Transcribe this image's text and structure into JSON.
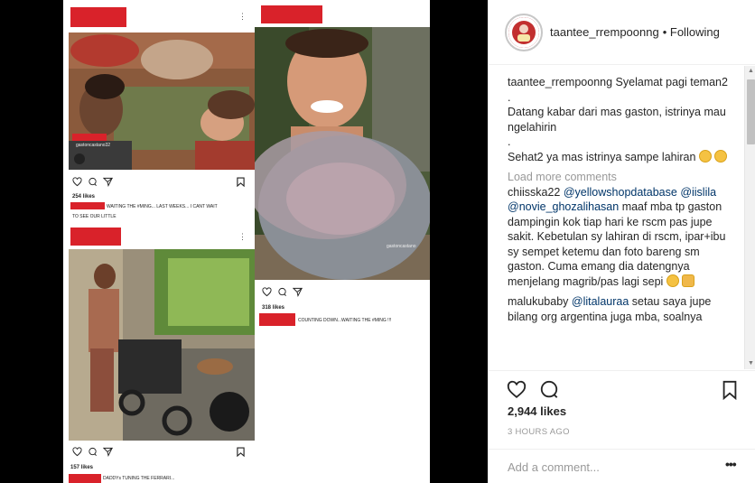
{
  "collage": {
    "top_left": {
      "photo_tag": "gastoncastano32",
      "likes": "254 likes",
      "caption": "WAITING THE #MING... LAST WEEKS... I CANT WAIT",
      "caption_line2": "TO SEE OUR LITTLE"
    },
    "right": {
      "photo_tag": "gastoncastano",
      "likes": "318 likes",
      "caption": "COUNTING DOWN...WAITING THE #MING !!!"
    },
    "bottom_left": {
      "likes": "157 likes",
      "caption": "DADDYs TUNING THE FERRARI..."
    }
  },
  "header": {
    "username": "taantee_rrempoonng",
    "separator": "•",
    "follow_state": "Following"
  },
  "comments": {
    "caption": {
      "username": "taantee_rrempoonng",
      "line1": "Syelamat pagi teman2",
      "dot1": ".",
      "line2": "Datang kabar dari mas gaston, istrinya mau ngelahirin",
      "dot2": ".",
      "line3": "Sehat2 ya mas istrinya sampe lahiran"
    },
    "load_more": "Load more comments",
    "items": [
      {
        "username": "chiisska22",
        "mention1": "@yellowshopdatabase",
        "mention2": "@iislila",
        "mention3": "@novie_ghozalihasan",
        "text": "maaf mba tp gaston dampingin kok tiap hari ke rscm pas jupe sakit. Kebetulan sy lahiran di rscm, ipar+ibu sy sempet ketemu dan foto bareng sm gaston. Cuma emang dia datengnya menjelang magrib/pas lagi sepi"
      },
      {
        "username": "malukubaby",
        "mention1": "@litalauraa",
        "text": "setau saya jupe bilang org argentina juga mba, soalnya"
      }
    ]
  },
  "actions": {
    "likes": "2,944 likes",
    "timestamp": "3 HOURS AGO"
  },
  "comment_box": {
    "placeholder": "Add a comment...",
    "more": "•••"
  },
  "colors": {
    "redaction": "#d9222a",
    "mention": "#003569",
    "muted": "#999999",
    "text": "#262626"
  }
}
